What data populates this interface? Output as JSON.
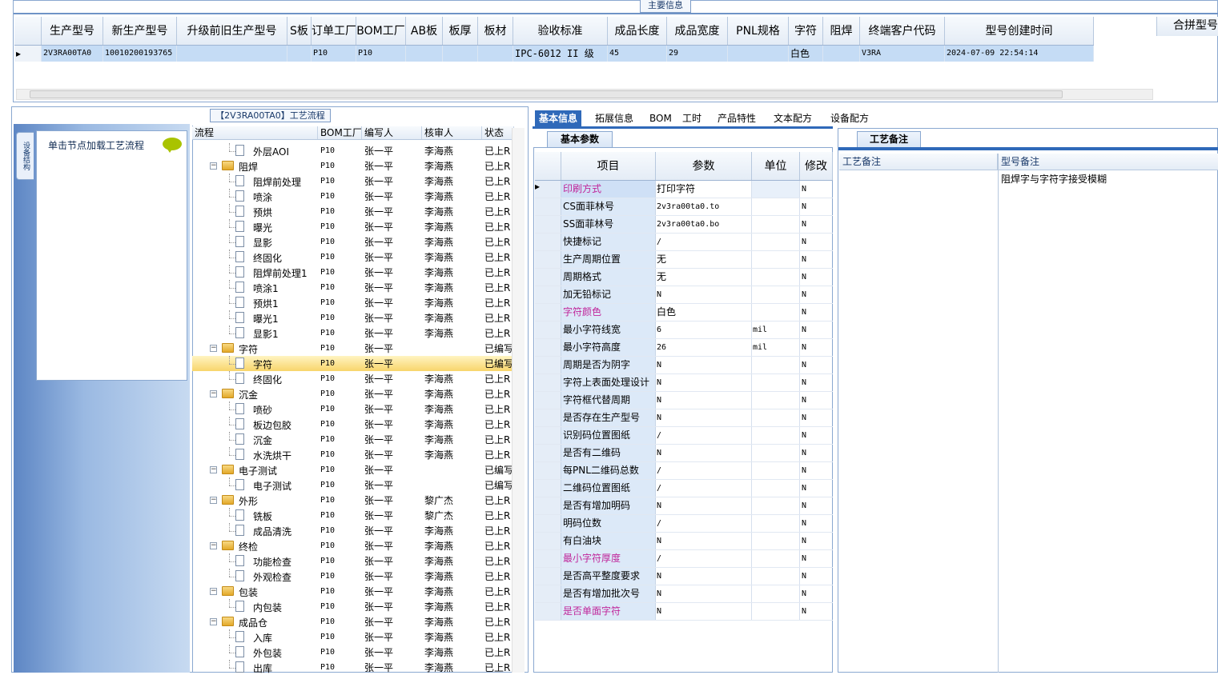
{
  "top": {
    "tab_label": "主要信息",
    "columns": [
      "生产型号",
      "新生产型号",
      "升级前旧生产型号",
      "S板",
      "订单工厂",
      "BOM工厂",
      "AB板",
      "板厚",
      "板材",
      "验收标准",
      "成品长度",
      "成品宽度",
      "PNL规格",
      "字符",
      "阻焊",
      "终端客户代码",
      "型号创建时间"
    ],
    "row": [
      "2V3RA00TA0",
      "10010200193765",
      "",
      "",
      "P10",
      "P10",
      "",
      "",
      "",
      "IPC-6012 II 级",
      "45",
      "29",
      "",
      "白色",
      "",
      "V3RA",
      "2024-07-09 22:54:14"
    ],
    "merge_header": "合拼型号"
  },
  "left": {
    "flow_tab": "【2V3RA00TA0】工艺流程",
    "vertical_tab": "设备结构",
    "node_hint": "单击节点加载工艺流程",
    "tree_headers": [
      "流程",
      "BOM工厂",
      "编写人",
      "核审人",
      "状态"
    ],
    "tree_rows": [
      {
        "label": "外层AOI",
        "level": 2,
        "type": "doc",
        "bom": "P10",
        "writer": "张一平",
        "reviewer": "李海燕",
        "status": "已上R"
      },
      {
        "label": "阻焊",
        "level": 1,
        "type": "folder",
        "bom": "P10",
        "writer": "张一平",
        "reviewer": "李海燕",
        "status": "已上R"
      },
      {
        "label": "阻焊前处理",
        "level": 2,
        "type": "doc",
        "bom": "P10",
        "writer": "张一平",
        "reviewer": "李海燕",
        "status": "已上R"
      },
      {
        "label": "喷涂",
        "level": 2,
        "type": "doc",
        "bom": "P10",
        "writer": "张一平",
        "reviewer": "李海燕",
        "status": "已上R"
      },
      {
        "label": "预烘",
        "level": 2,
        "type": "doc",
        "bom": "P10",
        "writer": "张一平",
        "reviewer": "李海燕",
        "status": "已上R"
      },
      {
        "label": "曝光",
        "level": 2,
        "type": "doc",
        "bom": "P10",
        "writer": "张一平",
        "reviewer": "李海燕",
        "status": "已上R"
      },
      {
        "label": "显影",
        "level": 2,
        "type": "doc",
        "bom": "P10",
        "writer": "张一平",
        "reviewer": "李海燕",
        "status": "已上R"
      },
      {
        "label": "终固化",
        "level": 2,
        "type": "doc",
        "bom": "P10",
        "writer": "张一平",
        "reviewer": "李海燕",
        "status": "已上R"
      },
      {
        "label": "阻焊前处理1",
        "level": 2,
        "type": "doc",
        "bom": "P10",
        "writer": "张一平",
        "reviewer": "李海燕",
        "status": "已上R"
      },
      {
        "label": "喷涂1",
        "level": 2,
        "type": "doc",
        "bom": "P10",
        "writer": "张一平",
        "reviewer": "李海燕",
        "status": "已上R"
      },
      {
        "label": "预烘1",
        "level": 2,
        "type": "doc",
        "bom": "P10",
        "writer": "张一平",
        "reviewer": "李海燕",
        "status": "已上R"
      },
      {
        "label": "曝光1",
        "level": 2,
        "type": "doc",
        "bom": "P10",
        "writer": "张一平",
        "reviewer": "李海燕",
        "status": "已上R"
      },
      {
        "label": "显影1",
        "level": 2,
        "type": "doc",
        "bom": "P10",
        "writer": "张一平",
        "reviewer": "李海燕",
        "status": "已上R"
      },
      {
        "label": "字符",
        "level": 1,
        "type": "folder",
        "bom": "P10",
        "writer": "张一平",
        "reviewer": "",
        "status": "已编写"
      },
      {
        "label": "字符",
        "level": 2,
        "type": "doc",
        "bom": "P10",
        "writer": "张一平",
        "reviewer": "",
        "status": "已编写",
        "selected": true
      },
      {
        "label": "终固化",
        "level": 2,
        "type": "doc",
        "bom": "P10",
        "writer": "张一平",
        "reviewer": "李海燕",
        "status": "已上R"
      },
      {
        "label": "沉金",
        "level": 1,
        "type": "folder",
        "bom": "P10",
        "writer": "张一平",
        "reviewer": "李海燕",
        "status": "已上R"
      },
      {
        "label": "喷砂",
        "level": 2,
        "type": "doc",
        "bom": "P10",
        "writer": "张一平",
        "reviewer": "李海燕",
        "status": "已上R"
      },
      {
        "label": "板边包胶",
        "level": 2,
        "type": "doc",
        "bom": "P10",
        "writer": "张一平",
        "reviewer": "李海燕",
        "status": "已上R"
      },
      {
        "label": "沉金",
        "level": 2,
        "type": "doc",
        "bom": "P10",
        "writer": "张一平",
        "reviewer": "李海燕",
        "status": "已上R"
      },
      {
        "label": "水洗烘干",
        "level": 2,
        "type": "doc",
        "bom": "P10",
        "writer": "张一平",
        "reviewer": "李海燕",
        "status": "已上R"
      },
      {
        "label": "电子测试",
        "level": 1,
        "type": "folder",
        "bom": "P10",
        "writer": "张一平",
        "reviewer": "",
        "status": "已编写"
      },
      {
        "label": "电子测试",
        "level": 2,
        "type": "doc",
        "bom": "P10",
        "writer": "张一平",
        "reviewer": "",
        "status": "已编写"
      },
      {
        "label": "外形",
        "level": 1,
        "type": "folder",
        "bom": "P10",
        "writer": "张一平",
        "reviewer": "黎广杰",
        "status": "已上R"
      },
      {
        "label": "铣板",
        "level": 2,
        "type": "doc",
        "bom": "P10",
        "writer": "张一平",
        "reviewer": "黎广杰",
        "status": "已上R"
      },
      {
        "label": "成品清洗",
        "level": 2,
        "type": "doc",
        "bom": "P10",
        "writer": "张一平",
        "reviewer": "李海燕",
        "status": "已上R"
      },
      {
        "label": "终检",
        "level": 1,
        "type": "folder",
        "bom": "P10",
        "writer": "张一平",
        "reviewer": "李海燕",
        "status": "已上R"
      },
      {
        "label": "功能检查",
        "level": 2,
        "type": "doc",
        "bom": "P10",
        "writer": "张一平",
        "reviewer": "李海燕",
        "status": "已上R"
      },
      {
        "label": "外观检查",
        "level": 2,
        "type": "doc",
        "bom": "P10",
        "writer": "张一平",
        "reviewer": "李海燕",
        "status": "已上R"
      },
      {
        "label": "包装",
        "level": 1,
        "type": "folder",
        "bom": "P10",
        "writer": "张一平",
        "reviewer": "李海燕",
        "status": "已上R"
      },
      {
        "label": "内包装",
        "level": 2,
        "type": "doc",
        "bom": "P10",
        "writer": "张一平",
        "reviewer": "李海燕",
        "status": "已上R"
      },
      {
        "label": "成品仓",
        "level": 1,
        "type": "folder",
        "bom": "P10",
        "writer": "张一平",
        "reviewer": "李海燕",
        "status": "已上R"
      },
      {
        "label": "入库",
        "level": 2,
        "type": "doc",
        "bom": "P10",
        "writer": "张一平",
        "reviewer": "李海燕",
        "status": "已上R"
      },
      {
        "label": "外包装",
        "level": 2,
        "type": "doc",
        "bom": "P10",
        "writer": "张一平",
        "reviewer": "李海燕",
        "status": "已上R"
      },
      {
        "label": "出库",
        "level": 2,
        "type": "doc",
        "bom": "P10",
        "writer": "张一平",
        "reviewer": "李海燕",
        "status": "已上R"
      }
    ]
  },
  "middle": {
    "tabs": [
      "基本信息",
      "拓展信息",
      "BOM",
      "工时",
      "产品特性",
      "文本配方",
      "设备配方"
    ],
    "sub_tab": "基本参数",
    "headers": [
      "项目",
      "参数",
      "单位",
      "修改"
    ],
    "rows": [
      {
        "name": "印刷方式",
        "value": "打印字符",
        "unit": "",
        "mod": "N",
        "pink": true
      },
      {
        "name": "CS面菲林号",
        "value": "2v3ra00ta0.to",
        "unit": "",
        "mod": "N"
      },
      {
        "name": "SS面菲林号",
        "value": "2v3ra00ta0.bo",
        "unit": "",
        "mod": "N"
      },
      {
        "name": "快捷标记",
        "value": "/",
        "unit": "",
        "mod": "N"
      },
      {
        "name": "生产周期位置",
        "value": "无",
        "unit": "",
        "mod": "N"
      },
      {
        "name": "周期格式",
        "value": "无",
        "unit": "",
        "mod": "N"
      },
      {
        "name": "加无铅标记",
        "value": "N",
        "unit": "",
        "mod": "N"
      },
      {
        "name": "字符颜色",
        "value": "白色",
        "unit": "",
        "mod": "N",
        "pink": true
      },
      {
        "name": "最小字符线宽",
        "value": "6",
        "unit": "mil",
        "mod": "N"
      },
      {
        "name": "最小字符高度",
        "value": "26",
        "unit": "mil",
        "mod": "N"
      },
      {
        "name": "周期是否为阴字",
        "value": "N",
        "unit": "",
        "mod": "N"
      },
      {
        "name": "字符上表面处理设计",
        "value": "N",
        "unit": "",
        "mod": "N"
      },
      {
        "name": "字符框代替周期",
        "value": "N",
        "unit": "",
        "mod": "N"
      },
      {
        "name": "是否存在生产型号",
        "value": "N",
        "unit": "",
        "mod": "N"
      },
      {
        "name": "识别码位置图纸",
        "value": "/",
        "unit": "",
        "mod": "N"
      },
      {
        "name": "是否有二维码",
        "value": "N",
        "unit": "",
        "mod": "N"
      },
      {
        "name": "每PNL二维码总数",
        "value": "/",
        "unit": "",
        "mod": "N"
      },
      {
        "name": "二维码位置图纸",
        "value": "/",
        "unit": "",
        "mod": "N"
      },
      {
        "name": "是否有增加明码",
        "value": "N",
        "unit": "",
        "mod": "N"
      },
      {
        "name": "明码位数",
        "value": "/",
        "unit": "",
        "mod": "N"
      },
      {
        "name": "有白油块",
        "value": "N",
        "unit": "",
        "mod": "N"
      },
      {
        "name": "最小字符厚度",
        "value": "/",
        "unit": "",
        "mod": "N",
        "pink": true
      },
      {
        "name": "是否高平整度要求",
        "value": "N",
        "unit": "",
        "mod": "N"
      },
      {
        "name": "是否有增加批次号",
        "value": "N",
        "unit": "",
        "mod": "N"
      },
      {
        "name": "是否单面字符",
        "value": "N",
        "unit": "",
        "mod": "N",
        "pink": true
      }
    ]
  },
  "right": {
    "tab": "工艺备注",
    "col1": "工艺备注",
    "col2": "型号备注",
    "note": "阻焊字与字符字接受模糊"
  }
}
